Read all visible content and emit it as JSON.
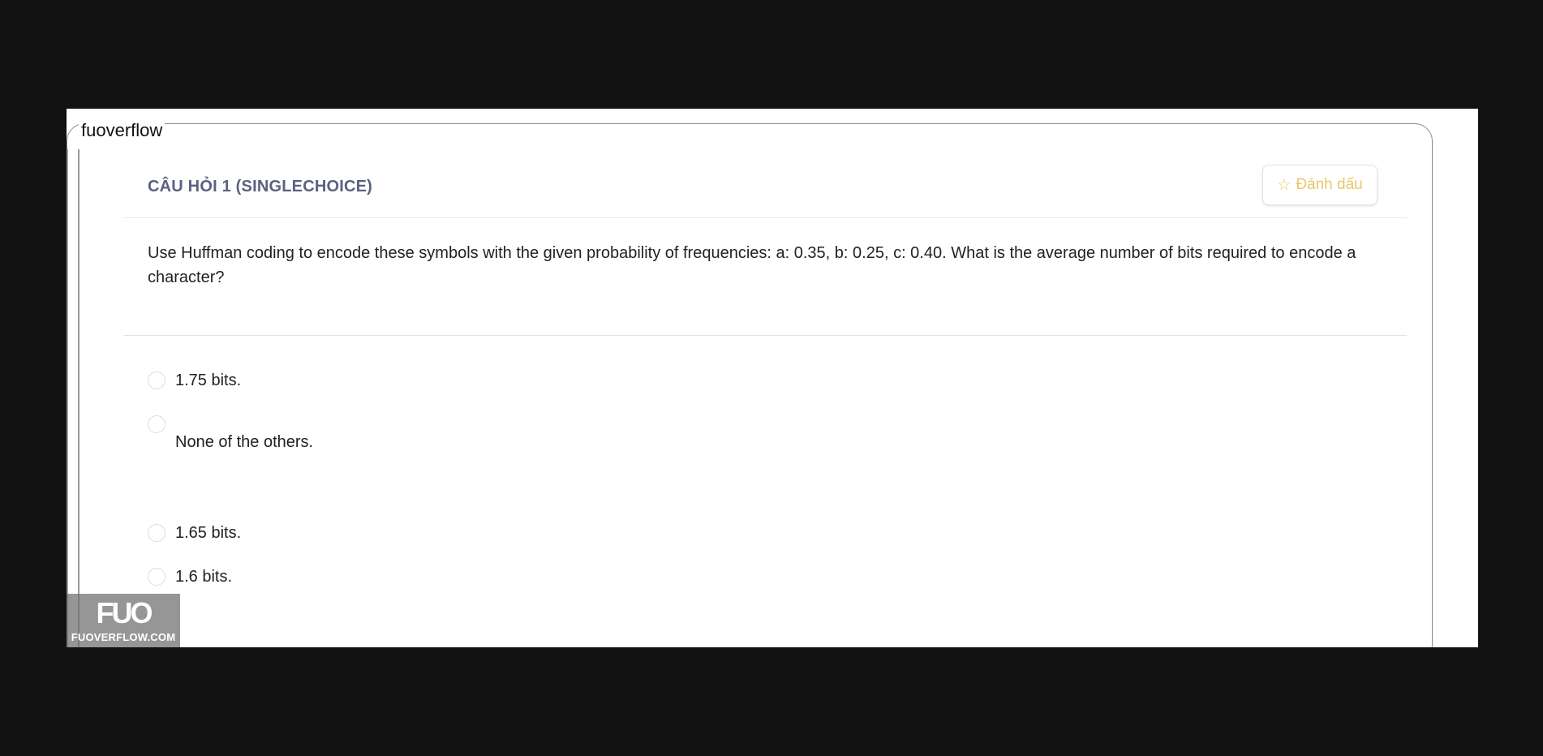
{
  "window": {
    "legend": "fuoverflow"
  },
  "question": {
    "title": "CÂU HỎI 1 (SINGLECHOICE)",
    "text": "Use Huffman coding to encode these symbols with the given probability of frequencies: a: 0.35, b: 0.25, c: 0.40. What is the average number of bits required to encode a character?",
    "bookmark_label": "Đánh dấu",
    "bookmark_icon": "star-outline-icon",
    "options": [
      {
        "label": "1.75 bits."
      },
      {
        "label": "None of the others."
      },
      {
        "label": "1.65 bits."
      },
      {
        "label": "1.6 bits."
      }
    ]
  },
  "watermark": {
    "logo_text": "FUO",
    "site_text": "FUOVERFLOW.COM"
  },
  "colors": {
    "background": "#111111",
    "title": "#5b6182",
    "bookmark": "#e8c86a"
  }
}
